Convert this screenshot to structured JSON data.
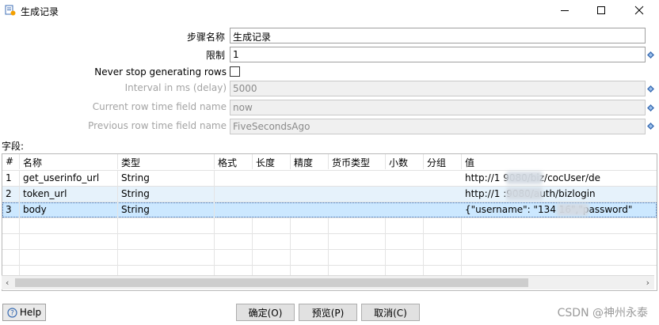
{
  "window": {
    "title": "生成记录"
  },
  "form": {
    "step_name_label": "步骤名称",
    "step_name_value": "生成记录",
    "limit_label": "限制",
    "limit_value": "1",
    "never_stop_label": "Never stop generating rows",
    "never_stop_checked": false,
    "interval_label": "Interval in ms (delay)",
    "interval_value": "5000",
    "current_time_label": "Current row time field name",
    "current_time_value": "now",
    "previous_time_label": "Previous row time field name",
    "previous_time_value": "FiveSecondsAgo"
  },
  "fields_label": "字段:",
  "table": {
    "columns": [
      "#",
      "名称",
      "类型",
      "格式",
      "长度",
      "精度",
      "货币类型",
      "小数",
      "分组",
      "值"
    ],
    "rows": [
      {
        "num": "1",
        "name": "get_userinfo_url",
        "type": "String",
        "value": "http://1          9080/biz/cocUser/de"
      },
      {
        "num": "2",
        "name": "token_url",
        "type": "String",
        "value": "http://1          :9080/auth/bizlogin"
      },
      {
        "num": "3",
        "name": "body",
        "type": "String",
        "value": "{\"username\": \"134          16\",\"password\""
      }
    ]
  },
  "buttons": {
    "help": "Help",
    "ok": "确定(O)",
    "preview": "预览(P)",
    "cancel": "取消(C)"
  },
  "watermark": "CSDN @神州永泰",
  "colors": {
    "row_selected": "#cce8ff",
    "row_alt": "#e6f2fb",
    "accent": "#3c6eb4"
  }
}
